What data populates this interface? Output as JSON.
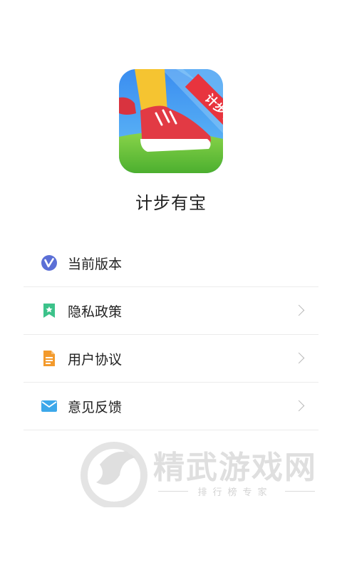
{
  "app": {
    "name": "计步有宝",
    "icon_banner": "计步有宝"
  },
  "menu": {
    "items": [
      {
        "label": "当前版本",
        "icon": "version-v-icon",
        "has_chevron": false
      },
      {
        "label": "隐私政策",
        "icon": "privacy-bookmark-icon",
        "has_chevron": true
      },
      {
        "label": "用户协议",
        "icon": "agreement-document-icon",
        "has_chevron": true
      },
      {
        "label": "意见反馈",
        "icon": "feedback-envelope-icon",
        "has_chevron": true
      }
    ]
  },
  "watermark": {
    "title": "精武游戏网",
    "subtitle": "排行榜专家"
  },
  "colors": {
    "version_icon": "#5b6fd6",
    "privacy_icon": "#3cc28a",
    "agreement_icon": "#f39a2c",
    "feedback_icon": "#3da8ea",
    "divider": "#ececec",
    "chevron": "#b8b8b8"
  }
}
